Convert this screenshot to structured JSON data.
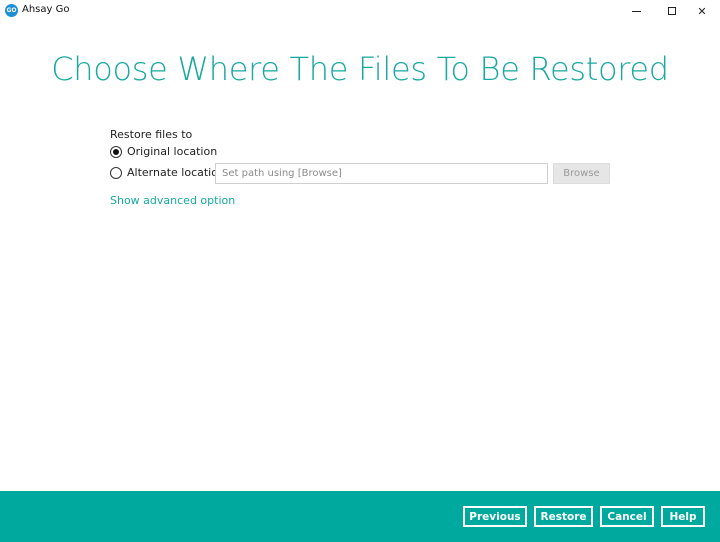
{
  "window": {
    "app_icon_text": "GO",
    "title": "Ahsay Go"
  },
  "page": {
    "title": "Choose Where The Files To Be Restored"
  },
  "restore": {
    "label": "Restore files to",
    "options": [
      {
        "label": "Original location",
        "selected": true
      },
      {
        "label": "Alternate location",
        "selected": false
      }
    ],
    "path_placeholder": "Set path using [Browse]",
    "browse_label": "Browse",
    "advanced_link": "Show advanced option"
  },
  "footer": {
    "previous": "Previous",
    "restore": "Restore",
    "cancel": "Cancel",
    "help": "Help"
  },
  "colors": {
    "accent": "#1aa8a0",
    "footer_bg": "#00a99d"
  }
}
